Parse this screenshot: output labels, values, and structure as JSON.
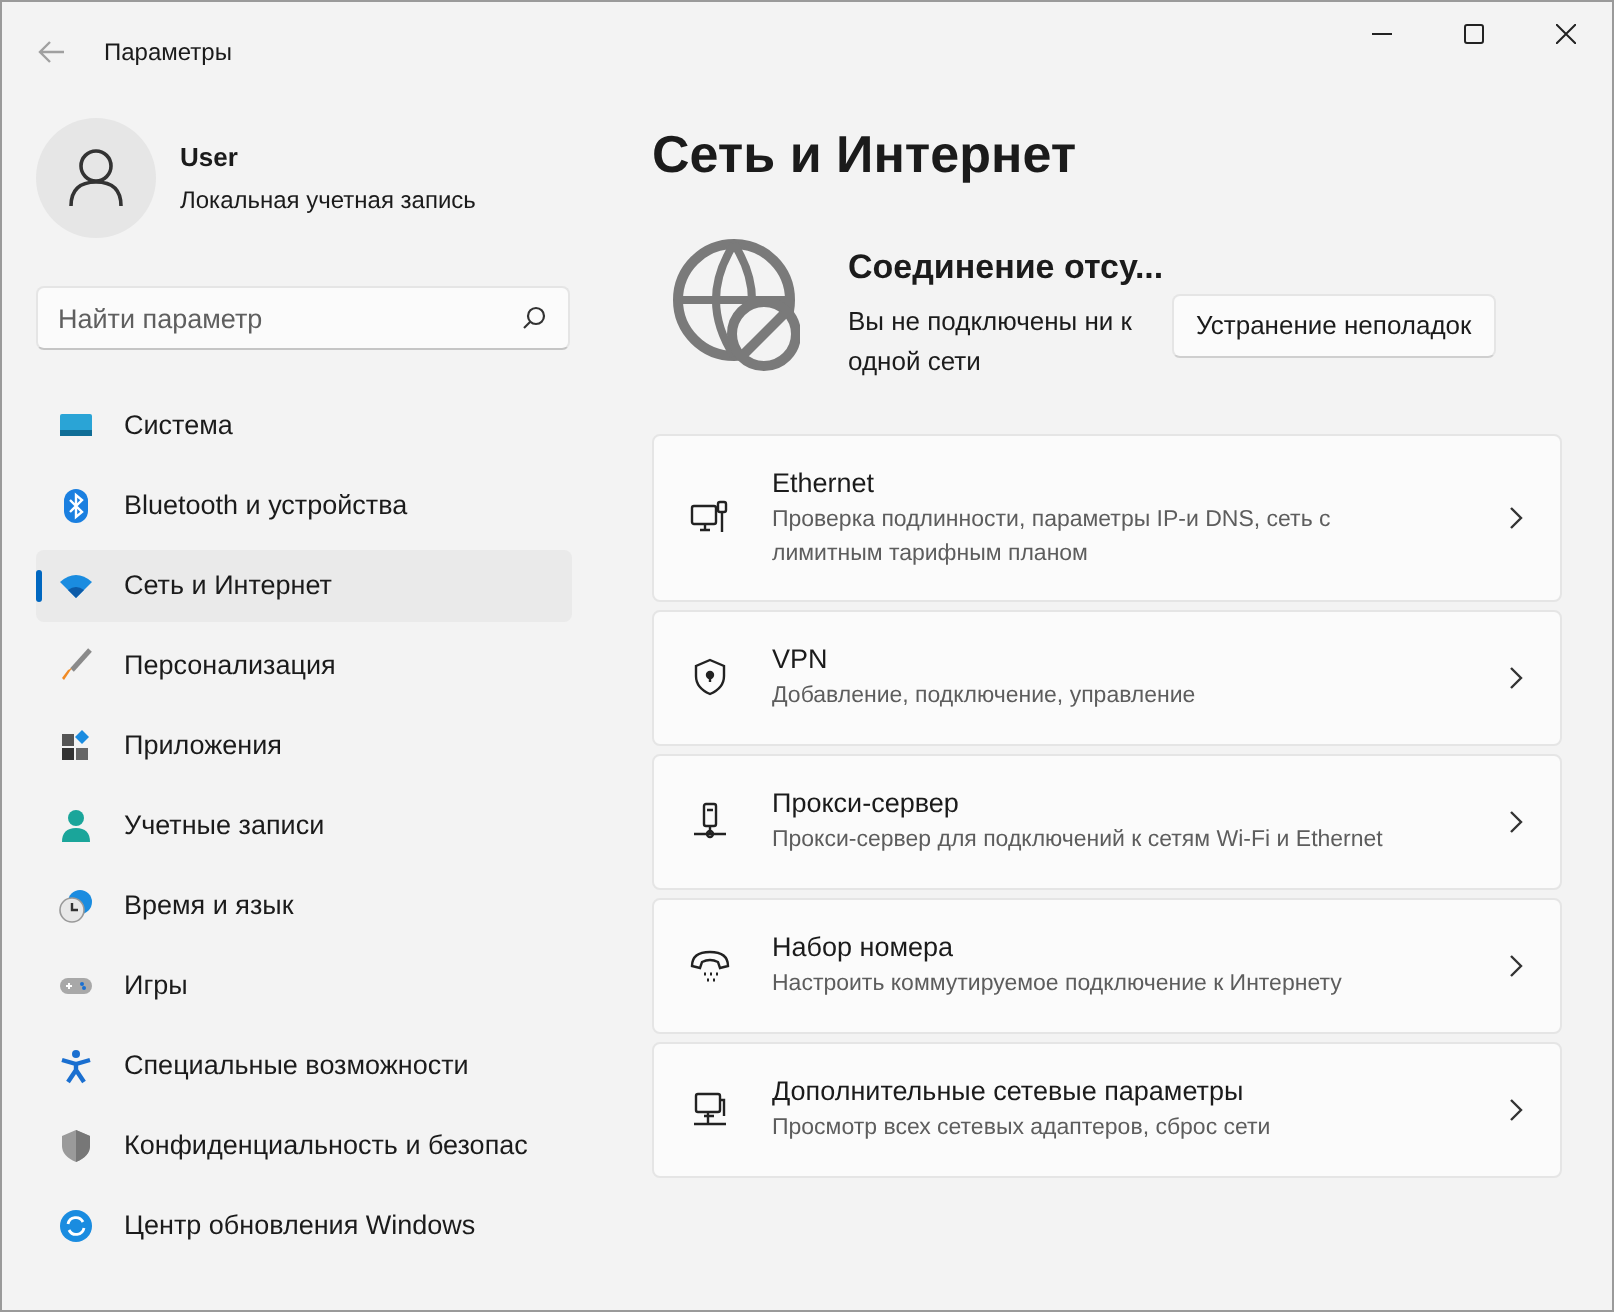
{
  "window": {
    "title": "Параметры"
  },
  "account": {
    "name": "User",
    "type": "Локальная учетная запись"
  },
  "search": {
    "placeholder": "Найти параметр"
  },
  "sidebar": {
    "items": [
      {
        "kind": "system",
        "label": "Система",
        "selected": false
      },
      {
        "kind": "bluetooth",
        "label": "Bluetooth и устройства",
        "selected": false
      },
      {
        "kind": "network",
        "label": "Сеть и Интернет",
        "selected": true
      },
      {
        "kind": "brush",
        "label": "Персонализация",
        "selected": false
      },
      {
        "kind": "apps",
        "label": "Приложения",
        "selected": false
      },
      {
        "kind": "accounts",
        "label": "Учетные записи",
        "selected": false
      },
      {
        "kind": "time",
        "label": "Время и язык",
        "selected": false
      },
      {
        "kind": "gaming",
        "label": "Игры",
        "selected": false
      },
      {
        "kind": "accessibility",
        "label": "Специальные возможности",
        "selected": false
      },
      {
        "kind": "privacy",
        "label": "Конфиденциальность и безопас",
        "selected": false
      },
      {
        "kind": "update",
        "label": "Центр обновления Windows",
        "selected": false
      }
    ]
  },
  "page_title": "Сеть и Интернет",
  "status": {
    "title": "Соединение отсу...",
    "description": "Вы не подключены ни к одной сети",
    "button": "Устранение неполадок"
  },
  "cards": [
    {
      "kind": "ethernet",
      "title": "Ethernet",
      "subtitle": "Проверка подлинности, параметры IP-и DNS, сеть с лимитным тарифным планом"
    },
    {
      "kind": "vpn",
      "title": "VPN",
      "subtitle": "Добавление, подключение, управление"
    },
    {
      "kind": "proxy",
      "title": "Прокси-сервер",
      "subtitle": "Прокси-сервер для подключений к сетям Wi-Fi и Ethernet"
    },
    {
      "kind": "dialup",
      "title": "Набор номера",
      "subtitle": "Настроить коммутируемое подключение к Интернету"
    },
    {
      "kind": "advanced",
      "title": "Дополнительные сетевые параметры",
      "subtitle": "Просмотр всех сетевых адаптеров, сброс сети"
    }
  ]
}
